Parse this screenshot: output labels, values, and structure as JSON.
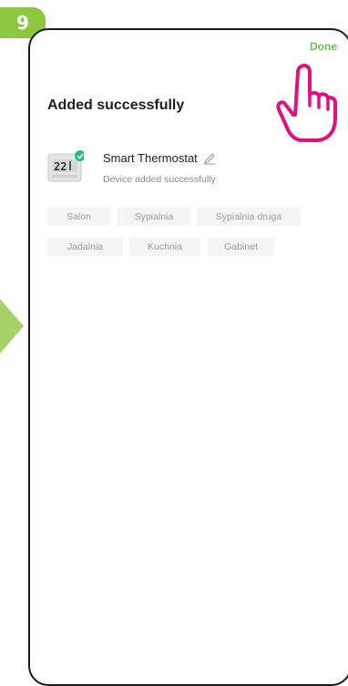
{
  "step": {
    "number": "9"
  },
  "header": {
    "done_label": "Done"
  },
  "page": {
    "title": "Added successfully"
  },
  "device": {
    "name": "Smart Thermostat",
    "status": "Device added successfully",
    "display_reading": "22"
  },
  "rooms": [
    "Salon",
    "Sypialnia",
    "Sypialnia druga",
    "Jadalnia",
    "Kuchnia",
    "Gabinet"
  ],
  "colors": {
    "accent_green": "#8dc63f",
    "done_green": "#6cc24a",
    "hand_magenta": "#e0117f",
    "check_teal": "#1fb98b"
  }
}
